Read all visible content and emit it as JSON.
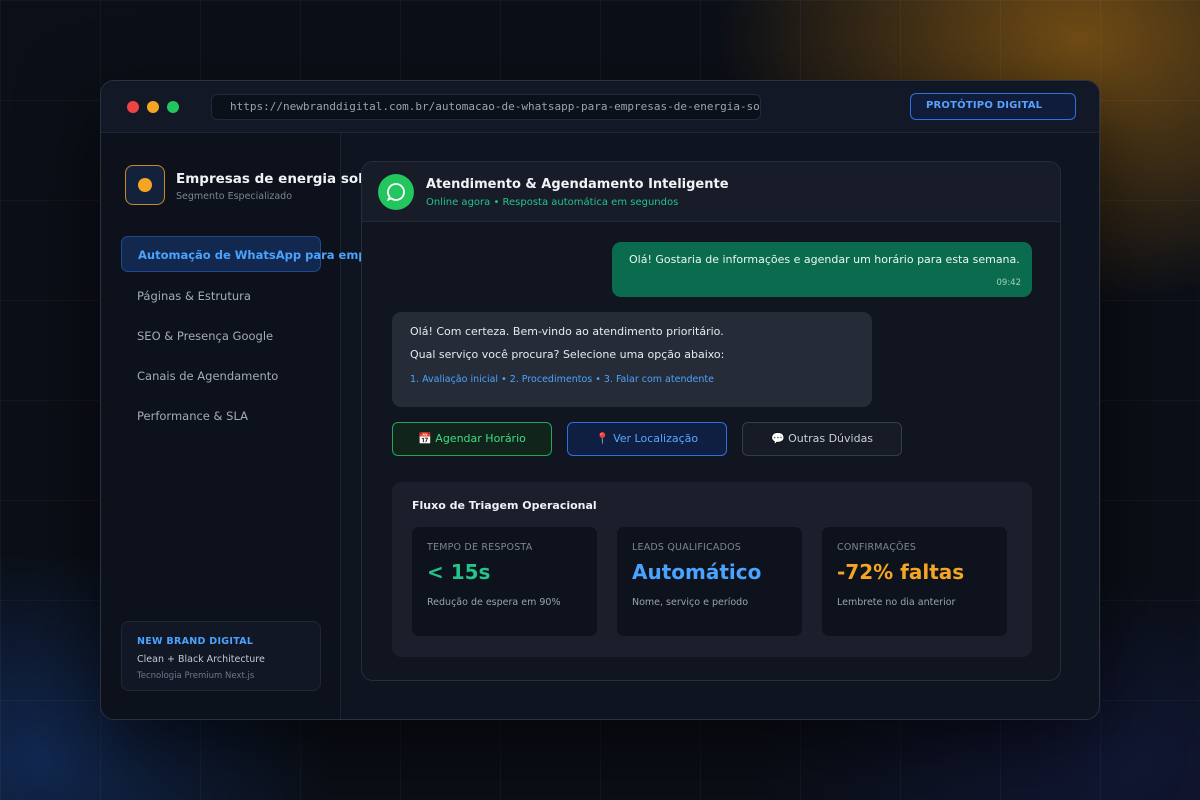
{
  "window": {
    "url": "https://newbranddigital.com.br/automacao-de-whatsapp-para-empresas-de-energia-solar",
    "badge": "PROTÓTIPO DIGITAL"
  },
  "sidebar": {
    "brand_title": "Empresas de energia solar",
    "brand_subtitle": "Segmento Especializado",
    "items": [
      {
        "label": "Automação de WhatsApp para empresa",
        "active": true
      },
      {
        "label": "Páginas & Estrutura"
      },
      {
        "label": "SEO & Presença Google"
      },
      {
        "label": "Canais de Agendamento"
      },
      {
        "label": "Performance & SLA"
      }
    ],
    "card": {
      "title": "NEW BRAND DIGITAL",
      "line1": "Clean + Black Architecture",
      "line2": "Tecnologia Premium Next.js"
    }
  },
  "chat": {
    "title": "Atendimento & Agendamento Inteligente",
    "status": "Online agora • Resposta automática em segundos",
    "outgoing": {
      "text": "Olá! Gostaria de informações e agendar um horário para esta semana.",
      "time": "09:42"
    },
    "incoming": {
      "line1": "Olá! Com certeza. Bem-vindo ao atendimento prioritário.",
      "line2": "Qual serviço você procura? Selecione uma opção abaixo:",
      "options": "1. Avaliação inicial • 2. Procedimentos • 3. Falar com atendente"
    },
    "quick_replies": {
      "schedule": "📅 Agendar Horário",
      "location": "📍 Ver Localização",
      "other": "💬 Outras Dúvidas"
    }
  },
  "flow": {
    "title": "Fluxo de Triagem Operacional",
    "metrics": [
      {
        "label": "TEMPO DE RESPOSTA",
        "value": "< 15s",
        "desc": "Redução de espera em 90%",
        "color": "#22c48a"
      },
      {
        "label": "LEADS QUALIFICADOS",
        "value": "Automático",
        "desc": "Nome, serviço e período",
        "color": "#4aa3ff"
      },
      {
        "label": "CONFIRMAÇÕES",
        "value": "-72% faltas",
        "desc": "Lembrete no dia anterior",
        "color": "#f5a524"
      }
    ]
  },
  "colors": {
    "accent_blue": "#4aa3ff",
    "accent_green": "#22c55e",
    "accent_orange": "#f5a524"
  },
  "icons": {
    "brand": "sun-circle-icon",
    "chat_avatar": "whatsapp-icon",
    "schedule": "calendar-icon",
    "location": "pin-icon",
    "other": "speech-bubble-icon"
  }
}
